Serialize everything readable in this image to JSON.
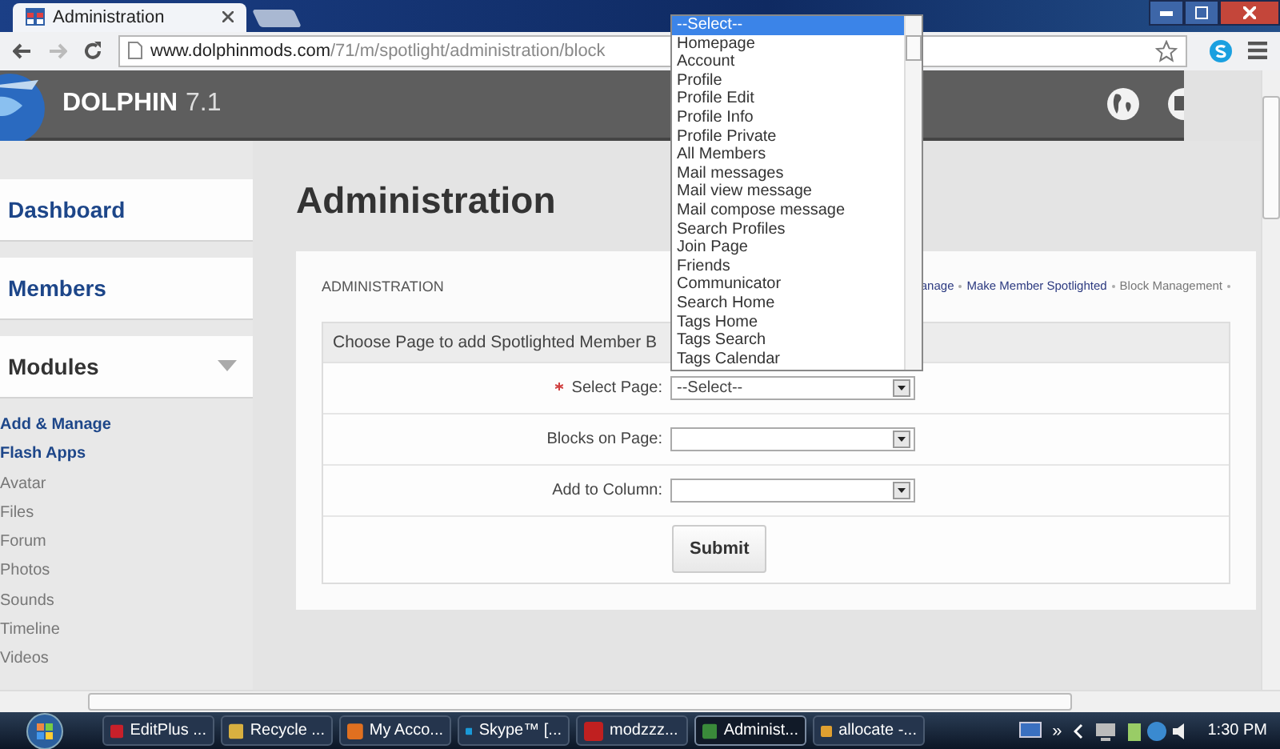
{
  "browser": {
    "tab_title": "Administration",
    "url_host": "www.dolphinmods.com",
    "url_path": "/71/m/spotlight/administration/block"
  },
  "site": {
    "logo_text": "DOLPHIN",
    "version": "7.1"
  },
  "sidebar": {
    "cards": [
      {
        "label": "Dashboard",
        "kind": "link"
      },
      {
        "label": "Members",
        "kind": "link"
      },
      {
        "label": "Modules",
        "kind": "expandable"
      }
    ],
    "links": [
      {
        "label": "Add & Manage",
        "active": true
      },
      {
        "label": "Flash Apps",
        "active": true
      },
      {
        "label": "Avatar",
        "active": false
      },
      {
        "label": "Files",
        "active": false
      },
      {
        "label": "Forum",
        "active": false
      },
      {
        "label": "Photos",
        "active": false
      },
      {
        "label": "Sounds",
        "active": false
      },
      {
        "label": "Timeline",
        "active": false
      },
      {
        "label": "Videos",
        "active": false
      }
    ]
  },
  "page_title": "Administration",
  "panel": {
    "heading": "ADMINISTRATION",
    "breadcrumb": [
      {
        "label": "anage",
        "current": false
      },
      {
        "label": "Make Member Spotlighted",
        "current": false
      },
      {
        "label": "Block Management",
        "current": true
      }
    ],
    "form_title": "Choose Page to add Spotlighted Member B",
    "fields": [
      {
        "label": "Select Page:",
        "required": true,
        "value": "--Select--"
      },
      {
        "label": "Blocks on Page:",
        "required": false
      },
      {
        "label": "Add to Column:",
        "required": false
      }
    ],
    "submit": "Submit"
  },
  "dropdown": {
    "options": [
      {
        "label": "--Select--",
        "selected": true
      },
      {
        "label": "Homepage",
        "selected": false
      },
      {
        "label": "Account",
        "selected": false
      },
      {
        "label": "Profile",
        "selected": false
      },
      {
        "label": "Profile Edit",
        "selected": false
      },
      {
        "label": "Profile Info",
        "selected": false
      },
      {
        "label": "Profile Private",
        "selected": false
      },
      {
        "label": "All Members",
        "selected": false
      },
      {
        "label": "Mail messages",
        "selected": false
      },
      {
        "label": "Mail view message",
        "selected": false
      },
      {
        "label": "Mail compose message",
        "selected": false
      },
      {
        "label": "Search Profiles",
        "selected": false
      },
      {
        "label": "Join Page",
        "selected": false
      },
      {
        "label": "Friends",
        "selected": false
      },
      {
        "label": "Communicator",
        "selected": false
      },
      {
        "label": "Search Home",
        "selected": false
      },
      {
        "label": "Tags Home",
        "selected": false
      },
      {
        "label": "Tags Search",
        "selected": false
      },
      {
        "label": "Tags Calendar",
        "selected": false
      }
    ]
  },
  "taskbar": {
    "items": [
      {
        "label": "EditPlus ...",
        "selected": false
      },
      {
        "label": "Recycle ...",
        "selected": false
      },
      {
        "label": "My Acco...",
        "selected": false
      },
      {
        "label": "Skype™ [...",
        "selected": false
      },
      {
        "label": "modzzz...",
        "selected": false
      },
      {
        "label": "Administ...",
        "selected": true
      },
      {
        "label": "allocate -...",
        "selected": false
      }
    ],
    "overflow": "»",
    "clock": "1:30 PM"
  }
}
